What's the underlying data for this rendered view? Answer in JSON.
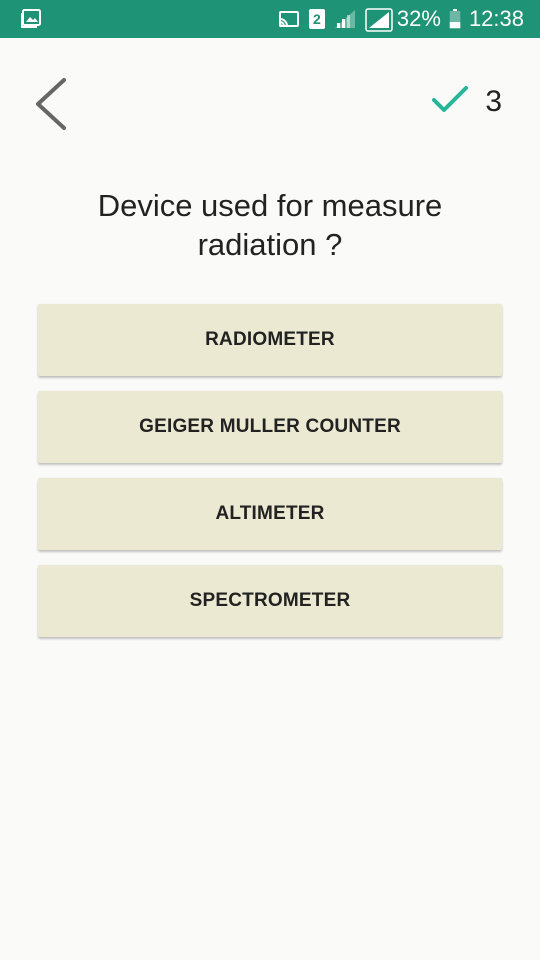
{
  "status_bar": {
    "left_icon": "gallery-icon",
    "icons": [
      "cast-icon",
      "sim-2-icon",
      "signal-weak-icon",
      "signal-full-icon",
      "battery-icon"
    ],
    "sim_number": "2",
    "battery": "32%",
    "time": "12:38"
  },
  "header": {
    "back_icon": "chevron-left-icon",
    "score_icon": "checkmark-icon",
    "score": "3"
  },
  "question": {
    "text": "Device used for measure radiation ?"
  },
  "options": [
    {
      "label": "RADIOMETER"
    },
    {
      "label": "GEIGER MULLER COUNTER"
    },
    {
      "label": "ALTIMETER"
    },
    {
      "label": "SPECTROMETER"
    }
  ],
  "colors": {
    "status_bar": "#1f9376",
    "accent_check": "#26b597",
    "option_bg": "#ebe9d1",
    "background": "#fafaf8"
  }
}
